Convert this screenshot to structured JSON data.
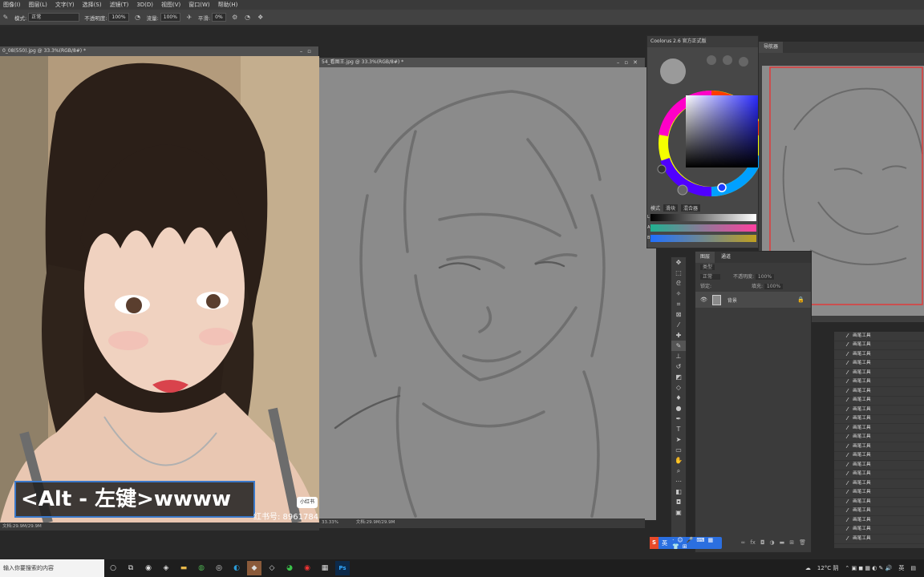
{
  "menubar": {
    "items": [
      "图像(I)",
      "图层(L)",
      "文字(Y)",
      "选择(S)",
      "滤镜(T)",
      "3D(D)",
      "视图(V)",
      "窗口(W)",
      "帮助(H)"
    ]
  },
  "options": {
    "mode_label": "模式:",
    "mode_value": "正常",
    "opacity_label": "不透明度:",
    "opacity_value": "100%",
    "flow_label": "流量:",
    "flow_value": "100%",
    "smooth_label": "平滑:",
    "smooth_value": "0%"
  },
  "photo_window": {
    "title": "0_08(550).jpg @ 33.3%(RGB/8#) *",
    "status": "文档:29.9M/29.9M"
  },
  "sketch_window": {
    "title": "54_看图王.jpg @ 33.3%(RGB/8#) *",
    "zoom": "33.33%",
    "status": "文档:29.9M/29.9M"
  },
  "coolorus": {
    "title": "Coolorus 2.6 官方正式版",
    "mode_label": "模式",
    "tab_slider": "滑块",
    "tab_mixer": "混合器",
    "slider_labels": [
      "L",
      "A",
      "B"
    ]
  },
  "navigator": {
    "tab": "导航器"
  },
  "layers": {
    "tab_layers": "图层",
    "tab_channels": "通道",
    "search_placeholder": "类型",
    "blend_mode": "正常",
    "opacity_label": "不透明度:",
    "opacity_value": "100%",
    "lock_label": "锁定:",
    "fill_label": "填充:",
    "fill_value": "100%",
    "layer_name": "背景"
  },
  "history": {
    "items": [
      "画笔工具",
      "画笔工具",
      "画笔工具",
      "画笔工具",
      "画笔工具",
      "画笔工具",
      "画笔工具",
      "画笔工具",
      "画笔工具",
      "画笔工具",
      "画笔工具",
      "画笔工具",
      "画笔工具",
      "画笔工具",
      "画笔工具",
      "画笔工具",
      "画笔工具",
      "画笔工具",
      "画笔工具",
      "画笔工具",
      "画笔工具",
      "画笔工具",
      "画笔工具"
    ]
  },
  "caption": {
    "text": "<Alt - 左键>wwww"
  },
  "watermark": {
    "text": "红书号: 8961784",
    "logo": "小红书"
  },
  "ime": {
    "label": "英"
  },
  "taskbar": {
    "search_placeholder": "输入你要搜索的内容",
    "weather": "12°C 阴",
    "lang": "英"
  },
  "colors": {
    "accent_caption_border": "#3a78c9",
    "canvas_gray": "#8a8a8a",
    "nav_frame_red": "#e03b3b"
  }
}
